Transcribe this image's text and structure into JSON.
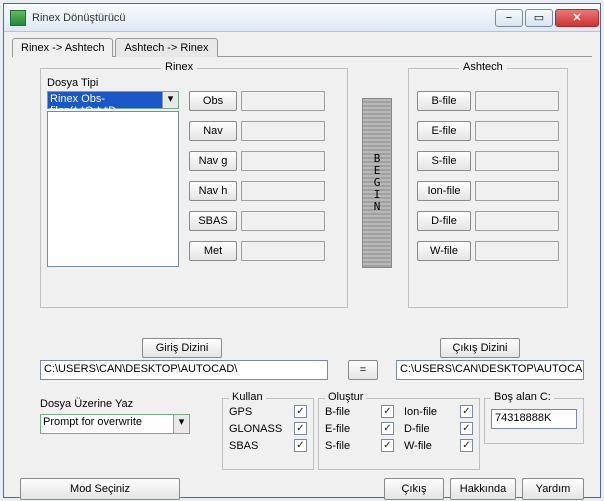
{
  "window": {
    "title": "Rinex Dönüştürücü"
  },
  "tabs": {
    "t1": "Rinex -> Ashtech",
    "t2": "Ashtech -> Rinex"
  },
  "rinexGroup": {
    "legend": "Rinex",
    "dosyaTipiLabel": "Dosya Tipi",
    "dosyaTipiValue": "Rinex Obs-files(*.*O;*.*D",
    "rows": {
      "obs": "Obs",
      "nav": "Nav",
      "navg": "Nav g",
      "navh": "Nav h",
      "sbas": "SBAS",
      "met": "Met"
    }
  },
  "ashtechGroup": {
    "legend": "Ashtech",
    "rows": {
      "b": "B-file",
      "e": "E-file",
      "s": "S-file",
      "ion": "Ion-file",
      "d": "D-file",
      "w": "W-file"
    }
  },
  "begin": "B\nE\nG\nI\nN",
  "dirs": {
    "inBtn": "Giriş Dizini",
    "outBtn": "Çıkış Dizini",
    "inPath": "C:\\USERS\\CAN\\DESKTOP\\AUTOCAD\\",
    "outPath": "C:\\USERS\\CAN\\DESKTOP\\AUTOCAD\\",
    "eq": "="
  },
  "overwrite": {
    "label": "Dosya Üzerine Yaz",
    "value": "Prompt for overwrite"
  },
  "kullan": {
    "legend": "Kullan",
    "gps": "GPS",
    "glonass": "GLONASS",
    "sbas": "SBAS"
  },
  "olustur": {
    "legend": "Oluştur",
    "b": "B-file",
    "e": "E-file",
    "s": "S-file",
    "ion": "Ion-file",
    "d": "D-file",
    "w": "W-file"
  },
  "bos": {
    "legend": "Boş alan C:",
    "value": "74318888K"
  },
  "footer": {
    "mod": "Mod Seçiniz",
    "cikis": "Çıkış",
    "hk": "Hakkında",
    "yardim": "Yardım"
  }
}
